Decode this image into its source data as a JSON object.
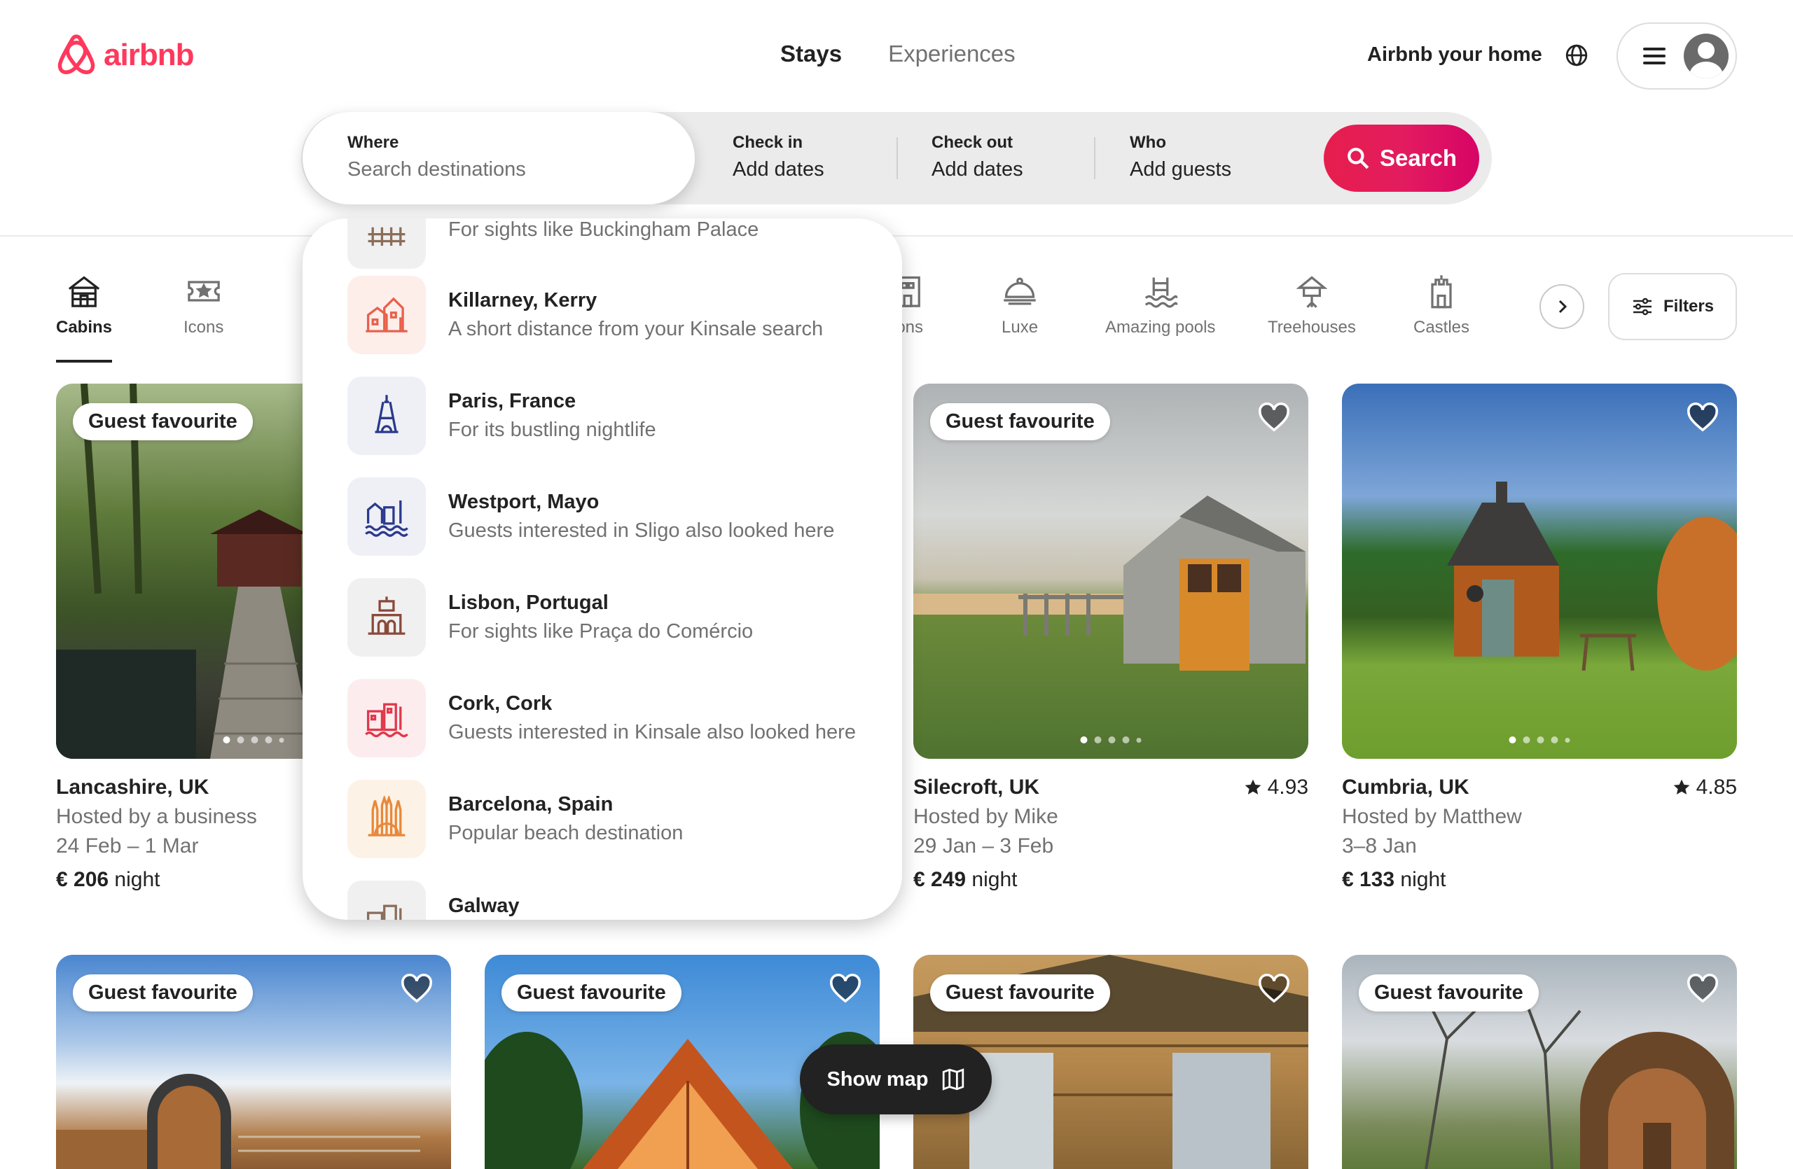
{
  "brand": {
    "name": "airbnb",
    "color": "#ff385c"
  },
  "nav": {
    "tabs": [
      "Stays",
      "Experiences"
    ],
    "active_tab": "Stays"
  },
  "header": {
    "host_link": "Airbnb your home"
  },
  "search": {
    "where_label": "Where",
    "where_placeholder": "Search destinations",
    "checkin_label": "Check in",
    "checkin_value": "Add dates",
    "checkout_label": "Check out",
    "checkout_value": "Add dates",
    "who_label": "Who",
    "who_value": "Add guests",
    "button_label": "Search"
  },
  "categories": {
    "items": [
      {
        "label": "Cabins",
        "icon": "cabin-icon",
        "active": true
      },
      {
        "label": "Icons",
        "icon": "ticket-star-icon"
      },
      {
        "label": "ions",
        "icon": "building-icon"
      },
      {
        "label": "Luxe",
        "icon": "luxe-bell-icon"
      },
      {
        "label": "Amazing pools",
        "icon": "pool-icon"
      },
      {
        "label": "Treehouses",
        "icon": "treehouse-icon"
      },
      {
        "label": "Castles",
        "icon": "castle-icon"
      }
    ],
    "filters_label": "Filters"
  },
  "suggestions": [
    {
      "title": "",
      "subtitle": "For sights like Buckingham Palace",
      "icon": "palace-icon",
      "color": "#8a6d5a"
    },
    {
      "title": "Killarney, Kerry",
      "subtitle": "A short distance from your Kinsale search",
      "icon": "town-icon",
      "color": "#e8614d"
    },
    {
      "title": "Paris, France",
      "subtitle": "For its bustling nightlife",
      "icon": "eiffel-tower-icon",
      "color": "#2b3a8c"
    },
    {
      "title": "Westport, Mayo",
      "subtitle": "Guests interested in Sligo also looked here",
      "icon": "harbour-icon",
      "color": "#2b3a8c"
    },
    {
      "title": "Lisbon, Portugal",
      "subtitle": "For sights like Praça do Comércio",
      "icon": "monument-icon",
      "color": "#8a4a3a"
    },
    {
      "title": "Cork, Cork",
      "subtitle": "Guests interested in Kinsale also looked here",
      "icon": "city-icon",
      "color": "#e0384a"
    },
    {
      "title": "Barcelona, Spain",
      "subtitle": "Popular beach destination",
      "icon": "sagrada-familia-icon",
      "color": "#e8883a"
    },
    {
      "title": "Galway",
      "subtitle": "",
      "icon": "city-icon",
      "color": "#8a6d5a"
    }
  ],
  "listings": [
    {
      "badge": "Guest favourite",
      "location": "Lancashire, UK",
      "host": "Hosted by a business",
      "dates": "24 Feb – 1 Mar",
      "price": "€ 206",
      "price_unit": "night",
      "rating": "",
      "photo": "boardwalk-cabin"
    },
    {
      "badge": "Guest favourite",
      "location": "Silecroft, UK",
      "host": "Hosted by Mike",
      "dates": "29 Jan – 3 Feb",
      "price": "€ 249",
      "price_unit": "night",
      "rating": "4.93",
      "photo": "beach-cabin"
    },
    {
      "badge": "",
      "location": "Cumbria, UK",
      "host": "Hosted by Matthew",
      "dates": "3–8 Jan",
      "price": "€ 133",
      "price_unit": "night",
      "rating": "4.85",
      "photo": "garden-cabin"
    },
    {
      "badge": "Guest favourite",
      "photo": "pod-cabin"
    },
    {
      "badge": "Guest favourite",
      "photo": "a-frame-cabin"
    },
    {
      "badge": "Guest favourite",
      "photo": "log-cabin"
    },
    {
      "badge": "Guest favourite",
      "photo": "barrel-cabin"
    }
  ],
  "show_map": {
    "label": "Show map"
  }
}
